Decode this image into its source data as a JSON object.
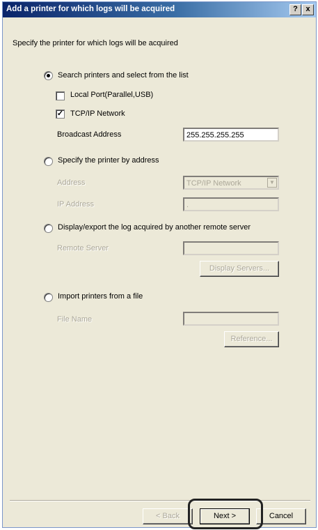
{
  "window": {
    "title": "Add a printer for which logs will be acquired",
    "help_label": "?",
    "close_label": "x"
  },
  "intro": "Specify the printer for which logs will be acquired",
  "option_search": {
    "label": "Search printers and select from the list",
    "selected": true,
    "local_port_label": "Local Port(Parallel,USB)",
    "local_port_checked": false,
    "tcpip_label": "TCP/IP Network",
    "tcpip_checked": true,
    "broadcast_label": "Broadcast Address",
    "broadcast_value": "255.255.255.255"
  },
  "option_address": {
    "label": "Specify the printer by address",
    "selected": false,
    "address_label": "Address",
    "address_value": "TCP/IP Network",
    "ip_label": "IP Address",
    "ip_value": "."
  },
  "option_remote": {
    "label": "Display/export the log acquired by another remote server",
    "selected": false,
    "server_label": "Remote Server",
    "server_value": "",
    "display_servers_label": "Display Servers..."
  },
  "option_import": {
    "label": "Import printers from a file",
    "selected": false,
    "file_label": "File Name",
    "file_value": "",
    "reference_label": "Reference..."
  },
  "footer": {
    "back_label": "< Back",
    "next_label": "Next >",
    "cancel_label": "Cancel"
  }
}
